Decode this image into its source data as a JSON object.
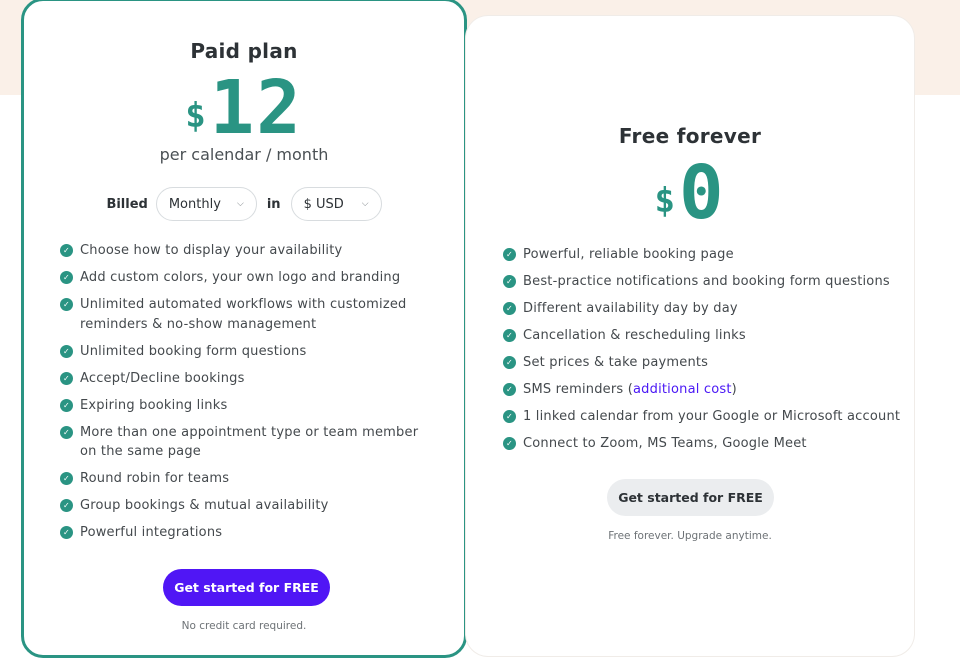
{
  "paid_plan": {
    "title": "Paid plan",
    "currency_symbol": "$",
    "price": "12",
    "period": "per calendar / month",
    "billed_label": "Billed",
    "billing_period": "Monthly",
    "in_label": "in",
    "currency": "$ USD",
    "features": [
      "Choose how to display your availability",
      "Add custom colors, your own logo and branding",
      "Unlimited automated workflows with customized reminders & no-show management",
      "Unlimited booking form questions",
      "Accept/Decline bookings",
      "Expiring booking links",
      "More than one appointment type or team member on the same page",
      "Round robin for teams",
      "Group bookings & mutual availability",
      "Powerful integrations"
    ],
    "cta": "Get started for FREE",
    "note": "No credit card required."
  },
  "free_plan": {
    "title": "Free forever",
    "currency_symbol": "$",
    "price": "0",
    "features": [
      "Powerful, reliable booking page",
      "Best-practice notifications and booking form questions",
      "Different availability day by day",
      "Cancellation & rescheduling links",
      "Set prices & take payments",
      "SMS reminders (",
      "1 linked calendar from your Google or Microsoft account",
      "Connect to Zoom, MS Teams, Google Meet"
    ],
    "sms_link": "additional cost",
    "sms_close": ")",
    "cta": "Get started for FREE",
    "note": "Free forever. Upgrade anytime."
  },
  "colors": {
    "accent_green": "#2a9483",
    "primary_button": "#5016f5",
    "background_band": "#faf0e8",
    "link": "#4b19f5"
  },
  "icons": {
    "feature_check": "check-circle-icon",
    "select_chevron": "chevron-down-icon"
  }
}
